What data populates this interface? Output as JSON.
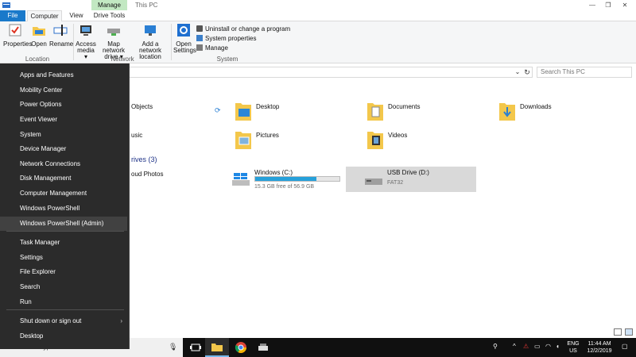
{
  "window": {
    "title": "This PC",
    "manage_tab": "Manage"
  },
  "tabs": [
    {
      "label": "File"
    },
    {
      "label": "Computer"
    },
    {
      "label": "View"
    },
    {
      "label": "Drive Tools"
    }
  ],
  "ribbon": {
    "location": {
      "label": "Location",
      "buttons": [
        {
          "label": "Properties",
          "icon": "properties-icon"
        },
        {
          "label": "Open",
          "icon": "open-folder-icon"
        },
        {
          "label": "Rename",
          "icon": "rename-icon"
        }
      ]
    },
    "network": {
      "label": "Network",
      "buttons": [
        {
          "line1": "Access",
          "line2": "media ▾",
          "icon": "access-media-icon"
        },
        {
          "line1": "Map network",
          "line2": "drive ▾",
          "icon": "map-drive-icon"
        },
        {
          "line1": "Add a network",
          "line2": "location",
          "icon": "network-location-icon"
        }
      ]
    },
    "system": {
      "label": "System",
      "open_settings_line1": "Open",
      "open_settings_line2": "Settings",
      "items": [
        {
          "label": "Uninstall or change a program"
        },
        {
          "label": "System properties"
        },
        {
          "label": "Manage"
        }
      ]
    }
  },
  "address": {
    "search_placeholder": "Search This PC"
  },
  "folders": [
    {
      "name": "Objects"
    },
    {
      "name": "Desktop"
    },
    {
      "name": "Documents"
    },
    {
      "name": "Downloads"
    },
    {
      "name": "usic"
    },
    {
      "name": "Pictures"
    },
    {
      "name": "Videos"
    }
  ],
  "drives_section": {
    "heading": "rives (3)"
  },
  "drives": [
    {
      "name": "oud Photos"
    },
    {
      "name": "Windows (C:)",
      "subtitle": "15.3 GB free of 56.9 GB",
      "used_fraction": 0.73
    },
    {
      "name": "USB Drive (D:)",
      "subtitle": "FAT32"
    }
  ],
  "winx_menu": {
    "items": [
      {
        "label": "Apps and Features"
      },
      {
        "label": "Mobility Center"
      },
      {
        "label": "Power Options"
      },
      {
        "label": "Event Viewer"
      },
      {
        "label": "System"
      },
      {
        "label": "Device Manager"
      },
      {
        "label": "Network Connections"
      },
      {
        "label": "Disk Management"
      },
      {
        "label": "Computer Management"
      },
      {
        "label": "Windows PowerShell"
      },
      {
        "label": "Windows PowerShell (Admin)"
      },
      {
        "label": "Task Manager"
      },
      {
        "label": "Settings"
      },
      {
        "label": "File Explorer"
      },
      {
        "label": "Search"
      },
      {
        "label": "Run"
      },
      {
        "label": "Shut down or sign out"
      },
      {
        "label": "Desktop"
      }
    ]
  },
  "taskbar": {
    "search_text": "Type here to search",
    "lang_line1": "ENG",
    "lang_line2": "US",
    "time": "11:44 AM",
    "date": "12/2/2019"
  },
  "colors": {
    "accent": "#1979ca",
    "menu_bg": "#2b2b2b",
    "drive_fill": "#26a0da",
    "folder_yellow": "#f3c74b"
  }
}
